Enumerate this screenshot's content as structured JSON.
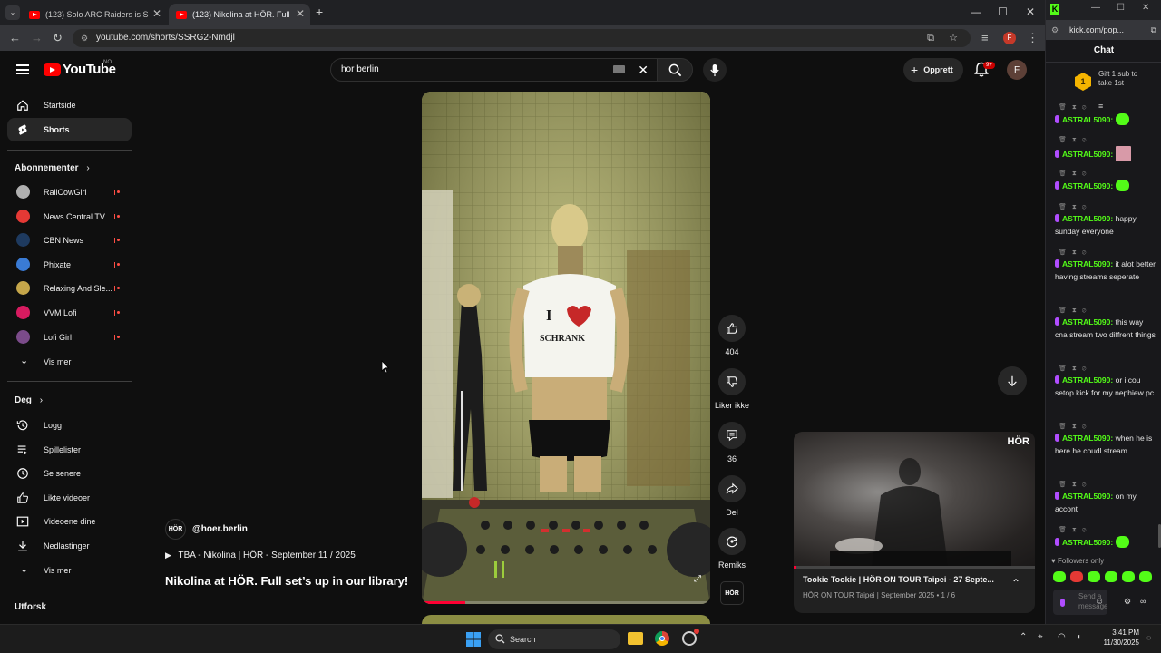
{
  "browser": {
    "tabs": [
      {
        "title": "(123) Solo ARC Raiders is S",
        "active": false
      },
      {
        "title": "(123) Nikolina at HÖR. Full",
        "active": true
      }
    ],
    "new_tab": "+",
    "url": "youtube.com/shorts/SSRG2-Nmdjl"
  },
  "youtube": {
    "logo": "YouTube",
    "region": "NO",
    "search_query": "hor berlin",
    "create_label": "Opprett",
    "notif_count": "9+",
    "avatar_letter": "F"
  },
  "sidebar": {
    "main": [
      {
        "label": "Startside",
        "icon": "home-icon"
      },
      {
        "label": "Shorts",
        "icon": "shorts-icon",
        "active": true
      }
    ],
    "subs_header": "Abonnementer",
    "subs": [
      {
        "label": "RailCowGirl",
        "color": "#b0b0b0"
      },
      {
        "label": "News Central TV",
        "color": "#e53935"
      },
      {
        "label": "CBN News",
        "color": "#1e3a5f"
      },
      {
        "label": "Phixate",
        "color": "#3a7bd5"
      },
      {
        "label": "Relaxing And Sle...",
        "color": "#c5a64a"
      },
      {
        "label": "VVM Lofi",
        "color": "#d81b60"
      },
      {
        "label": "Lofi Girl",
        "color": "#7b4b8a"
      }
    ],
    "subs_more": "Vis mer",
    "you_header": "Deg",
    "you": [
      {
        "label": "Logg",
        "icon": "history-icon"
      },
      {
        "label": "Spillelister",
        "icon": "playlist-icon"
      },
      {
        "label": "Se senere",
        "icon": "clock-icon"
      },
      {
        "label": "Likte videoer",
        "icon": "like-icon"
      },
      {
        "label": "Videoene dine",
        "icon": "video-icon"
      },
      {
        "label": "Nedlastinger",
        "icon": "download-icon"
      }
    ],
    "you_more": "Vis mer",
    "explore_header": "Utforsk"
  },
  "short": {
    "channel": "@hoer.berlin",
    "channel_logo": "HÖR",
    "music": "TBA - Nikolina | HÖR - September 11 / 2025",
    "title": "Nikolina at HÖR. Full set’s up in our library!",
    "actions": {
      "likes": "404",
      "dislike_label": "Liker ikke",
      "comments": "36",
      "share_label": "Del",
      "remix_label": "Remiks"
    },
    "progress": 0.15
  },
  "miniplayer": {
    "title": "Tookie Tookie | HÖR ON TOUR Taipei - 27 Septe...",
    "subtitle": "HÖR ON TOUR Taipei | September 2025 • 1 / 6",
    "logo": "HÖR"
  },
  "kick": {
    "url": "kick.com/pop...",
    "title": "Chat",
    "gift_number": "1",
    "gift_text": "Gift 1 sub to take 1st",
    "messages": [
      {
        "user": "ASTRAL5090:",
        "text": "",
        "emote": "green"
      },
      {
        "user": "ASTRAL5090:",
        "text": "",
        "emote": "pink"
      },
      {
        "user": "ASTRAL5090:",
        "text": "",
        "emote": "green"
      },
      {
        "user": "ASTRAL5090:",
        "text": "happy sunday everyone"
      },
      {
        "user": "ASTRAL5090:",
        "text": "it alot better having streams seperate"
      },
      {
        "user": "ASTRAL5090:",
        "text": "this way i cna stream two diffrent things"
      },
      {
        "user": "ASTRAL5090:",
        "text": "or i cou setop kick for my nephiew pc"
      },
      {
        "user": "ASTRAL5090:",
        "text": "when he is here he coudl stream"
      },
      {
        "user": "ASTRAL5090:",
        "text": "on my accont"
      },
      {
        "user": "ASTRAL5090:",
        "text": "",
        "emote": "green"
      }
    ],
    "followers_only": "Followers only",
    "send_placeholder": "Send a message"
  },
  "taskbar": {
    "search": "Search",
    "time": "3:41 PM",
    "date": "11/30/2025"
  }
}
